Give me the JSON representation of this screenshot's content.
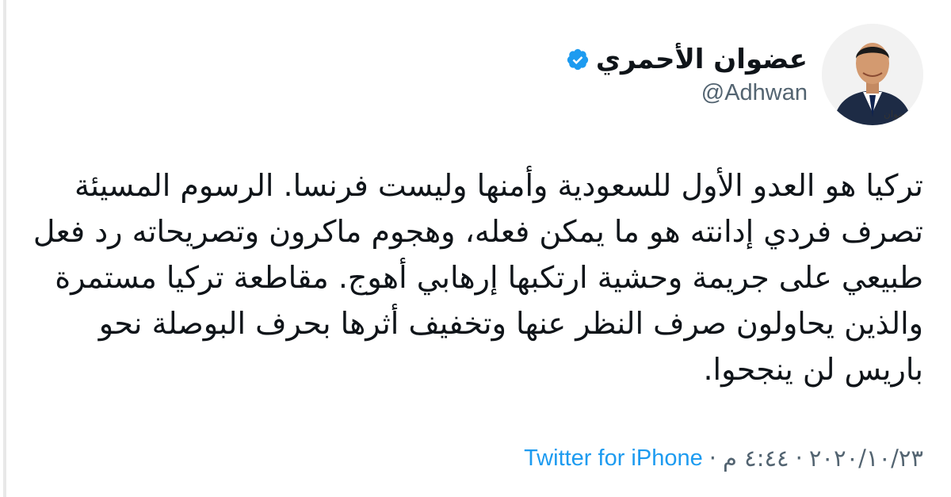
{
  "author": {
    "display_name": "عضوان الأحمري",
    "handle": "@Adhwan",
    "verified": true
  },
  "tweet": {
    "text": "تركيا هو العدو الأول للسعودية وأمنها وليست فرنسا. الرسوم المسيئة تصرف فردي إدانته هو ما يمكن فعله، وهجوم ماكرون وتصريحاته رد فعل طبيعي على جريمة وحشية ارتكبها إرهابي أهوج. مقاطعة تركيا مستمرة والذين يحاولون صرف النظر عنها وتخفيف أثرها بحرف البوصلة نحو باريس لن ينجحوا."
  },
  "meta": {
    "date": "٢٠٢٠/١٠/٢٣",
    "time": "٤:٤٤ م",
    "separator": "·",
    "source": "Twitter for iPhone"
  },
  "colors": {
    "text": "#0f1419",
    "secondary": "#536471",
    "link": "#1d9bf0",
    "verified": "#1d9bf0"
  }
}
